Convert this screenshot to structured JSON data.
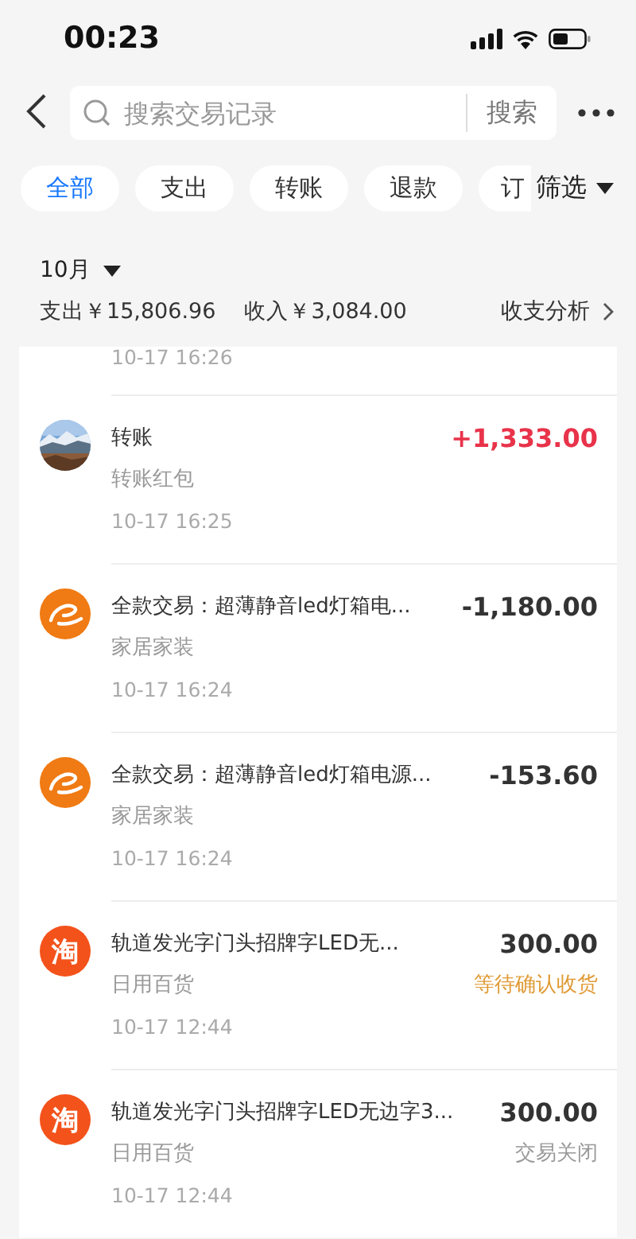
{
  "status_bar": {
    "time": "00:23"
  },
  "search": {
    "placeholder": "搜索交易记录",
    "button": "搜索"
  },
  "tabs": [
    {
      "label": "全部",
      "selected": true
    },
    {
      "label": "支出",
      "selected": false
    },
    {
      "label": "转账",
      "selected": false
    },
    {
      "label": "退款",
      "selected": false
    },
    {
      "label": "订",
      "selected": false
    }
  ],
  "filter": {
    "label": "筛选"
  },
  "summary": {
    "month": "10月",
    "expense": "支出￥15,806.96",
    "income": "收入￥3,084.00",
    "analysis": "收支分析"
  },
  "partial_row": {
    "time": "10-17 16:26"
  },
  "transactions": [
    {
      "kind": "avatar",
      "title": "转账",
      "category": "转账红包",
      "time": "10-17 16:25",
      "amount": "+1,333.00",
      "income": true
    },
    {
      "kind": "swirl",
      "title": "全款交易：超薄静音led灯箱电...",
      "category": "家居家装",
      "time": "10-17 16:24",
      "amount": "-1,180.00",
      "income": false
    },
    {
      "kind": "swirl",
      "title": "全款交易：超薄静音led灯箱电源...",
      "category": "家居家装",
      "time": "10-17 16:24",
      "amount": "-153.60",
      "income": false
    },
    {
      "kind": "char",
      "icon_text": "淘",
      "title": "轨道发光字门头招牌字LED无...",
      "category": "日用百货",
      "time": "10-17 12:44",
      "amount": "300.00",
      "income": false,
      "status": "等待确认收货",
      "color": "#e09a35"
    },
    {
      "kind": "char",
      "icon_text": "淘",
      "title": "轨道发光字门头招牌字LED无边字3...",
      "category": "日用百货",
      "time": "10-17 12:44",
      "amount": "300.00",
      "income": false,
      "status": "交易关闭",
      "color": "#999999"
    }
  ]
}
